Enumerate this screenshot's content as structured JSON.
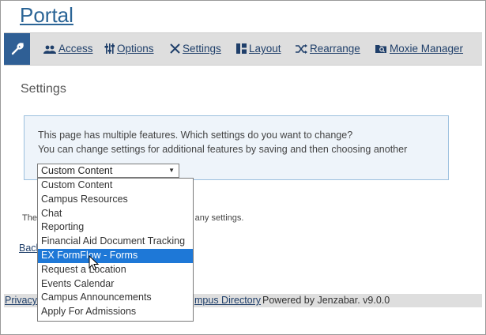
{
  "portal_title": "Portal",
  "nav": {
    "items": [
      {
        "label": "Access",
        "icon": "users-icon"
      },
      {
        "label": "Options",
        "icon": "sliders-icon"
      },
      {
        "label": "Settings",
        "icon": "tools-icon"
      },
      {
        "label": "Layout",
        "icon": "layout-icon"
      },
      {
        "label": "Rearrange",
        "icon": "shuffle-icon"
      },
      {
        "label": "Moxie Manager",
        "icon": "folder-search-icon"
      }
    ],
    "tool_icon": "wrench-icon"
  },
  "page_heading": "Settings",
  "info": {
    "line1": "This page has multiple features. Which settings do you want to change?",
    "line2": "You can change settings for additional features by saving and then choosing another"
  },
  "feature_select": {
    "value": "Custom Content",
    "options": [
      "Custom Content",
      "Campus Resources",
      "Chat",
      "Reporting",
      "Financial Aid Document Tracking",
      "EX FormFlow - Forms",
      "Request a Location",
      "Events Calendar",
      "Campus Announcements",
      "Apply For Admissions"
    ],
    "highlighted": "EX FormFlow - Forms"
  },
  "note": {
    "start": "The",
    "end": "ve any settings."
  },
  "back_label": "Back",
  "footer": {
    "privacy": "Privacy",
    "directory": "mpus Directory",
    "powered": "Powered by Jenzabar. v9.0.0"
  },
  "colors": {
    "accent": "#2f5f95",
    "highlight": "#1e78d7",
    "info_bg": "#eef4fa"
  }
}
